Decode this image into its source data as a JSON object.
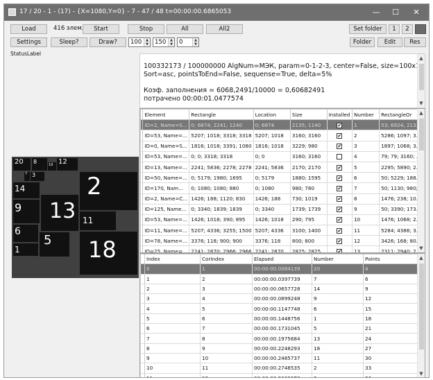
{
  "window": {
    "title": "17 / 20 - 1 - (17) - {X=1080,Y=0} - 7 - 47 / 48 t=00:00:00.6865053",
    "controls": [
      "—",
      "☐",
      "✕"
    ]
  },
  "toolbar": {
    "load": "Load",
    "count": "416 элем.",
    "start": "Start",
    "stop": "Stop",
    "all": "All",
    "all2": "All2",
    "settings": "Settings",
    "sleep": "Sleep?",
    "draw": "Draw?",
    "spin1": "100",
    "spin2": "150",
    "spin3": "0",
    "set_folder": "Set folder",
    "one": "1",
    "two": "2",
    "folder": "Folder",
    "edit": "Edit",
    "res": "Res"
  },
  "status_label": "StatusLabel",
  "info": {
    "line1": "100332173 / 100000000          AlgNum=МЭК, param=0-1-2-3, center=False, size=100x100,",
    "line2": "Sort=asc, pointsToEnd=False, sequense=True, delta=5%",
    "line3": "Коэф. заполнения = 6068,2491/10000 = 0,60682491",
    "line4": "потрачено 00:00:01.0477574"
  },
  "tiles": [
    "20",
    "8",
    "19",
    "12",
    "7",
    "3",
    "14",
    "2",
    "9",
    "13",
    "11",
    "6",
    "5",
    "18",
    "1"
  ],
  "grid1": {
    "columns": [
      "Element",
      "Rectangle",
      "Location",
      "Size",
      "Installed",
      "Number",
      "RectangleOr"
    ],
    "rows": [
      [
        "ID=2, Name=S...",
        "0; 6874; 2241; 1240",
        "0; 6874",
        "2135; 1140",
        "true",
        "1",
        "53; 6924; 213..."
      ],
      [
        "ID=53, Name=...",
        "5207; 1018; 3318; 3318",
        "5207; 1018",
        "3160; 3160",
        "true",
        "2",
        "5286; 1097; 3..."
      ],
      [
        "ID=0, Name=S...",
        "1816; 1018; 3391; 1080",
        "1816; 1018",
        "3229; 980",
        "true",
        "3",
        "1897; 1068; 3..."
      ],
      [
        "ID=53, Name=...",
        "0; 0; 3318; 3318",
        "0; 0",
        "3160; 3160",
        "false",
        "4",
        "79; 79; 3160; ..."
      ],
      [
        "ID=13, Name=...",
        "2241; 5836; 2278; 2278",
        "2241; 5836",
        "2170; 2170",
        "true",
        "5",
        "2295; 5890; 2..."
      ],
      [
        "ID=50, Name=...",
        "0; 5179; 1980; 1695",
        "0; 5179",
        "1880; 1595",
        "true",
        "6",
        "50; 5229; 188..."
      ],
      [
        "ID=170, Nam...",
        "0; 1080; 1080; 880",
        "0; 1080",
        "980; 780",
        "true",
        "7",
        "50; 1130; 980;..."
      ],
      [
        "ID=2, Name=C...",
        "1426; 188; 1120; 830",
        "1426; 188",
        "730; 1019",
        "true",
        "8",
        "1476; 238; 10..."
      ],
      [
        "ID=125, Name...",
        "0; 3340; 1839; 1839",
        "0; 3340",
        "1739; 1739",
        "true",
        "9",
        "50; 3390; 173..."
      ],
      [
        "ID=53, Name=...",
        "1426; 1018; 390; 895",
        "1426; 1018",
        "290; 795",
        "true",
        "10",
        "1476; 1068; 2..."
      ],
      [
        "ID=11, Name=...",
        "5207; 4336; 3255; 1500",
        "5207; 4336",
        "3100; 1400",
        "true",
        "11",
        "5284; 4386; 3..."
      ],
      [
        "ID=78, Name=...",
        "3376; 118; 900; 900",
        "3376; 118",
        "800; 800",
        "true",
        "12",
        "3426; 168; 80..."
      ],
      [
        "ID=25, Name=...",
        "2241; 2870; 2966; 2966",
        "2241; 2870",
        "2825; 2825",
        "true",
        "13",
        "2311; 2940; 2..."
      ]
    ]
  },
  "grid2": {
    "columns": [
      "Index",
      "CorIndex",
      "Elapsed",
      "Number",
      "Points"
    ],
    "rows": [
      [
        "0",
        "1",
        "00:00:00.0084139",
        "20",
        "4"
      ],
      [
        "1",
        "2",
        "00:00:00.0397739",
        "7",
        "6"
      ],
      [
        "2",
        "3",
        "00:00:00.0657728",
        "14",
        "9"
      ],
      [
        "3",
        "4",
        "00:00:00.0899248",
        "9",
        "12"
      ],
      [
        "4",
        "5",
        "00:00:00.1147748",
        "6",
        "15"
      ],
      [
        "5",
        "6",
        "00:00:00.1448756",
        "1",
        "18"
      ],
      [
        "6",
        "7",
        "00:00:00.1731045",
        "5",
        "21"
      ],
      [
        "7",
        "8",
        "00:00:00.1975684",
        "13",
        "24"
      ],
      [
        "8",
        "9",
        "00:00:00.2248293",
        "18",
        "27"
      ],
      [
        "9",
        "10",
        "00:00:00.2485737",
        "11",
        "30"
      ],
      [
        "10",
        "11",
        "00:00:00.2748535",
        "2",
        "33"
      ],
      [
        "11",
        "12",
        "00:00:00.3008078",
        "3",
        "36"
      ]
    ]
  },
  "icons": {
    "app": "app-icon",
    "checkbox": "checkbox-checked-icon"
  }
}
